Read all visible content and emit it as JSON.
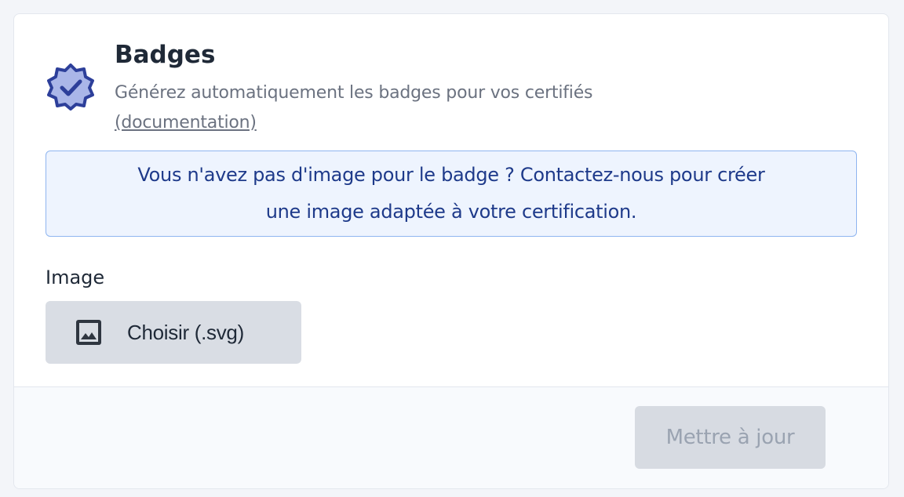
{
  "section": {
    "title": "Badges",
    "subtitle": "Générez automatiquement les badges pour vos certifiés",
    "doc_link": "(documentation)"
  },
  "info": {
    "message": "Vous n'avez pas d'image pour le badge ? Contactez-nous pour créer une image adaptée à votre certification."
  },
  "image_field": {
    "label": "Image",
    "button_label": "Choisir (.svg)"
  },
  "footer": {
    "update_label": "Mettre à jour",
    "update_disabled": true
  },
  "icons": {
    "badge": "verified-badge-icon",
    "image": "image-icon"
  },
  "colors": {
    "accent": "#2d3f9a",
    "badge_fill": "#aab6e8",
    "info_bg": "#eef4fe",
    "info_border": "#8fb5f0",
    "info_text": "#1e3a8a"
  }
}
